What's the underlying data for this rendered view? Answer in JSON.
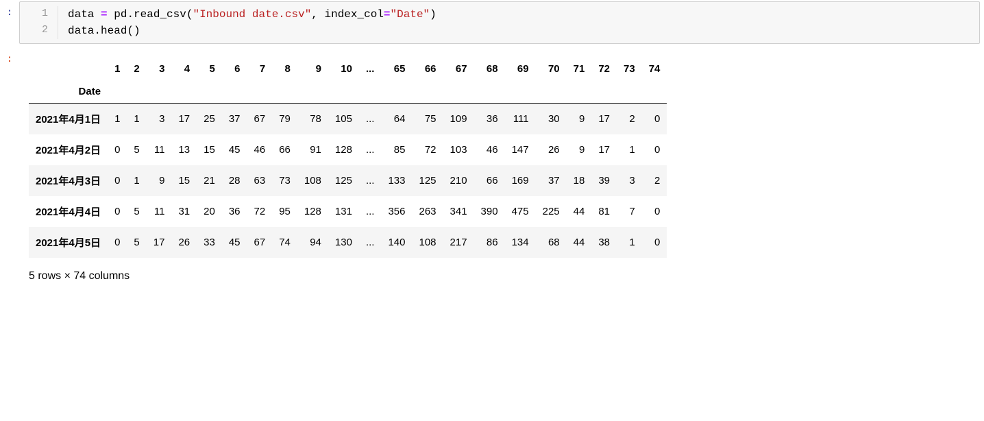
{
  "input": {
    "marker": ":",
    "lines": [
      {
        "num": "1",
        "tokens": [
          {
            "cls": "tok-nm",
            "t": "data "
          },
          {
            "cls": "tok-op",
            "t": "="
          },
          {
            "cls": "tok-nm",
            "t": " pd"
          },
          {
            "cls": "tok-punc",
            "t": "."
          },
          {
            "cls": "tok-nm",
            "t": "read_csv"
          },
          {
            "cls": "tok-punc",
            "t": "("
          },
          {
            "cls": "tok-str",
            "t": "\"Inbound date.csv\""
          },
          {
            "cls": "tok-punc",
            "t": ", index_col"
          },
          {
            "cls": "tok-op",
            "t": "="
          },
          {
            "cls": "tok-str",
            "t": "\"Date\""
          },
          {
            "cls": "tok-punc",
            "t": ")"
          }
        ]
      },
      {
        "num": "2",
        "tokens": [
          {
            "cls": "tok-nm",
            "t": "data"
          },
          {
            "cls": "tok-punc",
            "t": "."
          },
          {
            "cls": "tok-nm",
            "t": "head"
          },
          {
            "cls": "tok-punc",
            "t": "()"
          }
        ]
      }
    ]
  },
  "output": {
    "marker": ":",
    "index_label": "Date",
    "columns": [
      "1",
      "2",
      "3",
      "4",
      "5",
      "6",
      "7",
      "8",
      "9",
      "10",
      "...",
      "65",
      "66",
      "67",
      "68",
      "69",
      "70",
      "71",
      "72",
      "73",
      "74"
    ],
    "rows": [
      {
        "idx": "2021年4月1日",
        "cells": [
          "1",
          "1",
          "3",
          "17",
          "25",
          "37",
          "67",
          "79",
          "78",
          "105",
          "...",
          "64",
          "75",
          "109",
          "36",
          "111",
          "30",
          "9",
          "17",
          "2",
          "0"
        ]
      },
      {
        "idx": "2021年4月2日",
        "cells": [
          "0",
          "5",
          "11",
          "13",
          "15",
          "45",
          "46",
          "66",
          "91",
          "128",
          "...",
          "85",
          "72",
          "103",
          "46",
          "147",
          "26",
          "9",
          "17",
          "1",
          "0"
        ]
      },
      {
        "idx": "2021年4月3日",
        "cells": [
          "0",
          "1",
          "9",
          "15",
          "21",
          "28",
          "63",
          "73",
          "108",
          "125",
          "...",
          "133",
          "125",
          "210",
          "66",
          "169",
          "37",
          "18",
          "39",
          "3",
          "2"
        ]
      },
      {
        "idx": "2021年4月4日",
        "cells": [
          "0",
          "5",
          "11",
          "31",
          "20",
          "36",
          "72",
          "95",
          "128",
          "131",
          "...",
          "356",
          "263",
          "341",
          "390",
          "475",
          "225",
          "44",
          "81",
          "7",
          "0"
        ]
      },
      {
        "idx": "2021年4月5日",
        "cells": [
          "0",
          "5",
          "17",
          "26",
          "33",
          "45",
          "67",
          "74",
          "94",
          "130",
          "...",
          "140",
          "108",
          "217",
          "86",
          "134",
          "68",
          "44",
          "38",
          "1",
          "0"
        ]
      }
    ],
    "summary": "5 rows × 74 columns"
  }
}
